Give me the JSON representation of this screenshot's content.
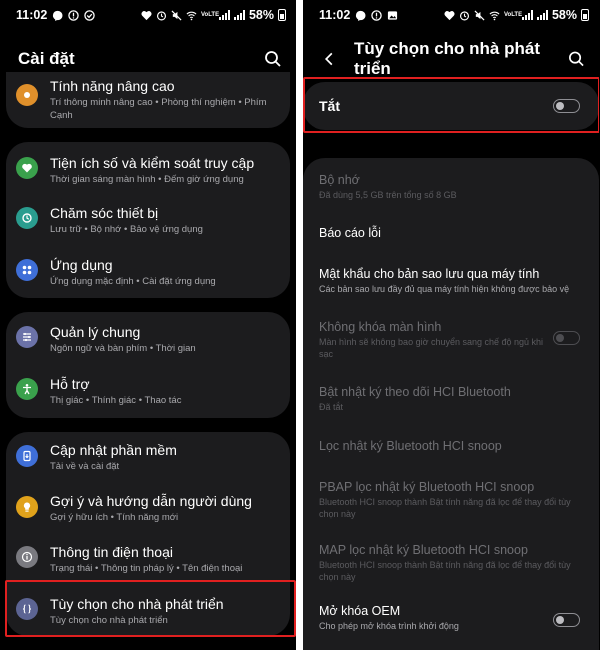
{
  "status_left": {
    "time": "11:02"
  },
  "status_right": {
    "network": "VoLTE",
    "battery": "58%"
  },
  "left": {
    "header_title": "Cài đặt",
    "partial_item": {
      "title": "Tính năng nâng cao",
      "subtitle": "Trí thông minh nâng cao  •  Phòng thí nghiệm  •  Phím Cạnh"
    },
    "cards": [
      {
        "items": [
          {
            "title": "Tiện ích số và kiểm soát truy cập",
            "subtitle": "Thời gian sáng màn hình  •  Đếm giờ ứng dụng",
            "icon": "digital-wellbeing-icon",
            "color": "#3aa14c"
          },
          {
            "title": "Chăm sóc thiết bị",
            "subtitle": "Lưu trữ  •  Bộ nhớ  •  Bảo vệ ứng dụng",
            "icon": "device-care-icon",
            "color": "#2a9d8f"
          },
          {
            "title": "Ứng dụng",
            "subtitle": "Ứng dụng mặc định  •  Cài đặt ứng dụng",
            "icon": "apps-icon",
            "color": "#3f6fd8"
          }
        ]
      },
      {
        "items": [
          {
            "title": "Quản lý chung",
            "subtitle": "Ngôn ngữ và bàn phím  •  Thời gian",
            "icon": "general-management-icon",
            "color": "#6b72a8"
          },
          {
            "title": "Hỗ trợ",
            "subtitle": "Thị giác  •  Thính giác  •  Thao tác",
            "icon": "accessibility-icon",
            "color": "#3aa14c"
          }
        ]
      },
      {
        "items": [
          {
            "title": "Cập nhật phần mềm",
            "subtitle": "Tải về và cài đặt",
            "icon": "software-update-icon",
            "color": "#3f6fd8"
          },
          {
            "title": "Gợi ý và hướng dẫn người dùng",
            "subtitle": "Gợi ý hữu ích  •  Tính năng mới",
            "icon": "tips-icon",
            "color": "#e0a21b"
          },
          {
            "title": "Thông tin điện thoại",
            "subtitle": "Trạng thái  •  Thông tin pháp lý  •  Tên điện thoại",
            "icon": "about-phone-icon",
            "color": "#7a7a80"
          },
          {
            "title": "Tùy chọn cho nhà phát triển",
            "subtitle": "Tùy chọn cho nhà phát triển",
            "icon": "developer-options-icon",
            "color": "#5c6493"
          }
        ]
      }
    ]
  },
  "right": {
    "header_title": "Tùy chọn cho nhà phát triển",
    "master_toggle_label": "Tắt",
    "items": [
      {
        "title": "Bộ nhớ",
        "subtitle": "Đã dùng 5,5 GB trên tổng số 8 GB",
        "disabled": true
      },
      {
        "title": "Báo cáo lỗi",
        "subtitle": "",
        "disabled": false
      },
      {
        "title": "Mật khẩu cho bản sao lưu qua máy tính",
        "subtitle": "Các bản sao lưu đầy đủ qua máy tính hiện không được bảo vệ",
        "disabled": false
      },
      {
        "title": "Không khóa màn hình",
        "subtitle": "Màn hình sẽ không bao giờ chuyển sang chế độ ngủ khi sạc",
        "disabled": true
      },
      {
        "title": "Bật nhật ký theo dõi HCI Bluetooth",
        "subtitle": "Đã tắt",
        "disabled": true
      },
      {
        "title": "Lọc nhật ký Bluetooth HCI snoop",
        "subtitle": "",
        "disabled": true
      },
      {
        "title": "PBAP lọc nhật ký Bluetooth HCI snoop",
        "subtitle": "Bluetooth HCI snoop thành Bật tính năng đã lọc để thay đổi tùy chọn này",
        "disabled": true
      },
      {
        "title": "MAP lọc nhật ký Bluetooth HCI snoop",
        "subtitle": "Bluetooth HCI snoop thành Bật tính năng đã lọc để thay đổi tùy chọn này",
        "disabled": true
      },
      {
        "title": "Mở khóa OEM",
        "subtitle": "Cho phép mở khóa trình khởi động",
        "disabled": false
      }
    ]
  },
  "colors": {
    "highlight": "#e02020",
    "card": "#1c1c1e",
    "background": "#000000"
  }
}
